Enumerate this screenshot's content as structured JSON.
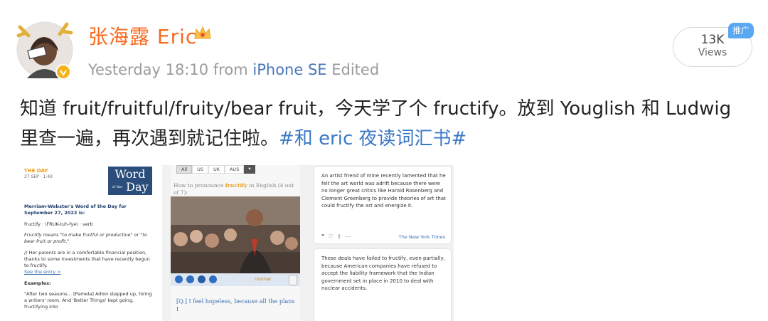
{
  "post": {
    "author": "张海露 Eric",
    "timestamp": "Yesterday 18:10",
    "from_label": "from",
    "source": "iPhone SE",
    "edited": "Edited",
    "views_count": "13K",
    "views_label": "Views",
    "promo_badge": "推广",
    "text": "知道 fruit/fruitful/fruity/bear fruit，今天学了个 fructify。放到 Youglish 和 Ludwig 里查一遍，再次遇到就记住啦。",
    "hashtag": "#和 eric 夜读词汇书#"
  },
  "thumb1": {
    "day_label": "THE DAY",
    "date": "27 SEP · 1:43",
    "logo_line1": "Word",
    "logo_line2": "Day",
    "logo_of": "of the",
    "heading": "Merriam-Webster's Word of the Day for September 27, 2022 is:",
    "word_line": "fructify · \\FRUK-tuh-fye\\ · verb",
    "definition": "Fructify means \"to make fruitful or productive\" or \"to bear fruit or profit.\"",
    "example_intro": "// Her parents are in a comfortable financial position, thanks to some investments that have recently begun to fructify.",
    "see_entry": "See the entry >",
    "examples_label": "Examples:",
    "example_text": "\"After two seasons... [Pamela] Adlon stepped up, hiring a writers' room. And 'Better Things' kept going, fructifying into"
  },
  "thumb2": {
    "tabs": [
      "All",
      "US",
      "UK",
      "AUS"
    ],
    "pronounce_prefix": "How to pronounce ",
    "pronounce_word": "fructify",
    "pronounce_suffix": " in English (4 out of 7):",
    "speed": "normal",
    "caption": "[Q.] I feel hopeless, because all the plans I"
  },
  "thumb3": {
    "quote1": "An artist friend of mine recently lamented that he felt the art world was adrift because there were no longer great critics like Harold Rosenberg and Clement Greenberg to provide theories of art that could fructify the art and energize it.",
    "source1": "The New York Times",
    "quote2": "These deals have failed to fructify, even partially, because American companies have refused to accept the liability framework that the Indian government set in place in 2010 to deal with nuclear accidents."
  },
  "colors": {
    "username": "#f86a1f",
    "link": "#3a78c4",
    "badge": "#5aa7f2"
  },
  "icons": [
    "avatar",
    "crown-icon",
    "verified-icon",
    "like-icon",
    "share-icon",
    "play-icon"
  ]
}
